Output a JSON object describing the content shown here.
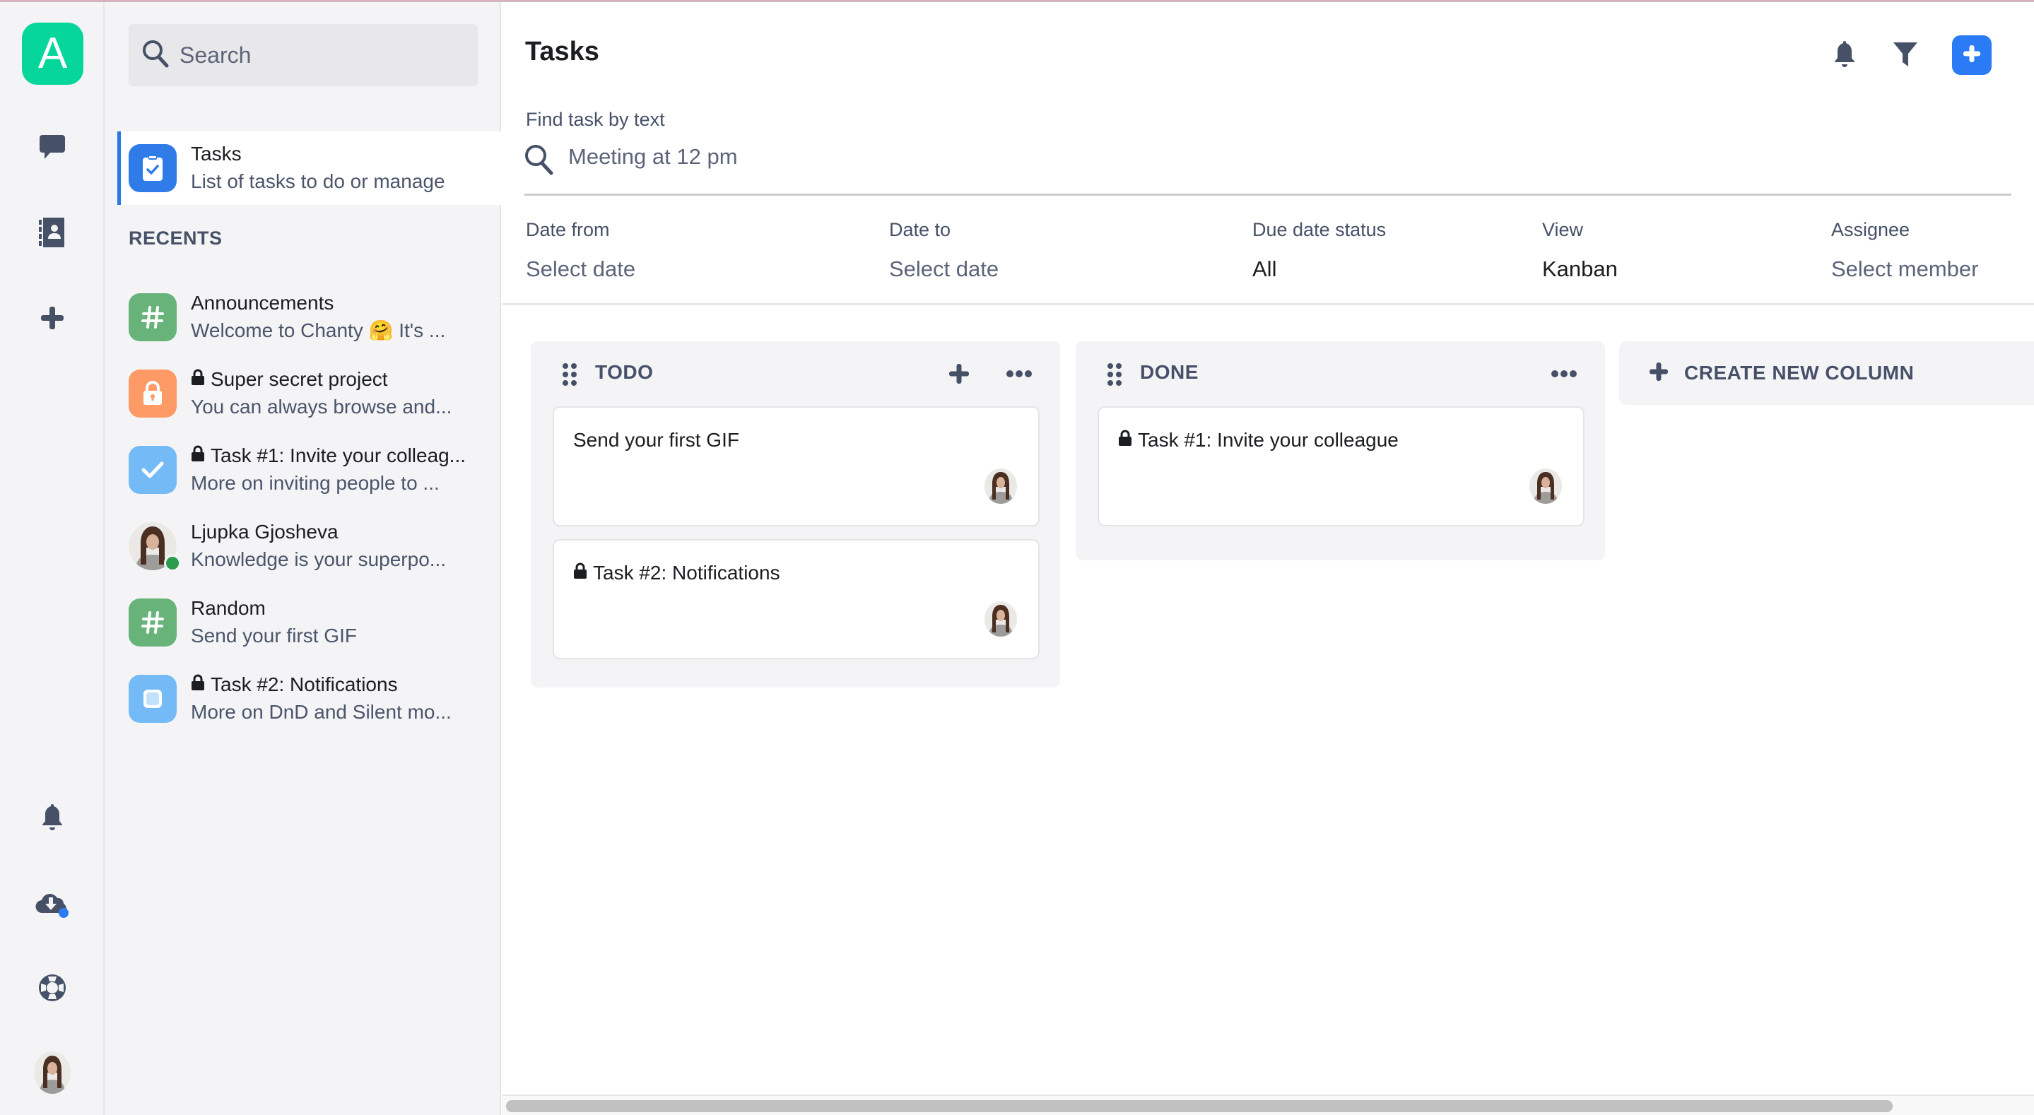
{
  "app": {
    "workspace_initial": "A",
    "brand_color": "#06d69b",
    "accent_color": "#2a7bf5"
  },
  "rail": {
    "top_icons": [
      {
        "name": "chat-icon",
        "label": "Messages"
      },
      {
        "name": "contacts-icon",
        "label": "Contacts"
      },
      {
        "name": "add-icon",
        "label": "Add"
      }
    ],
    "bottom_icons": [
      {
        "name": "bell-icon",
        "label": "Notifications"
      },
      {
        "name": "cloud-download-icon",
        "label": "Download",
        "badge": true
      },
      {
        "name": "lifebuoy-icon",
        "label": "Help"
      },
      {
        "name": "avatar",
        "label": "Profile"
      }
    ]
  },
  "sidebar": {
    "search_placeholder": "Search",
    "active": {
      "title": "Tasks",
      "subtitle": "List of tasks to do or manage",
      "icon": "clipboard-check-icon",
      "color": "#2f7be8"
    },
    "recents_label": "RECENTS",
    "recents": [
      {
        "title": "Announcements",
        "subtitle": "Welcome to Chanty 🤗 It's ...",
        "icon": "hash-icon",
        "color": "#67b37a",
        "locked": false
      },
      {
        "title": "Super secret project",
        "subtitle": "You can always browse and...",
        "icon": "lock-icon",
        "color": "#fd9a66",
        "locked": true
      },
      {
        "title": "Task #1: Invite your colleag...",
        "subtitle": "More on inviting people to ...",
        "icon": "check-icon",
        "color": "#73baf6",
        "locked": true
      },
      {
        "title": "Ljupka Gjosheva",
        "subtitle": "Knowledge is your superpo...",
        "icon": "avatar",
        "color": "",
        "locked": false,
        "online": true
      },
      {
        "title": "Random",
        "subtitle": "Send your first GIF",
        "icon": "hash-icon",
        "color": "#67b37a",
        "locked": false
      },
      {
        "title": "Task #2: Notifications",
        "subtitle": "More on DnD and Silent mo...",
        "icon": "square-icon",
        "color": "#73baf6",
        "locked": true
      }
    ]
  },
  "main": {
    "title": "Tasks",
    "header_icons": [
      "bell-icon",
      "filter-icon",
      "plus-icon"
    ],
    "find": {
      "label": "Find task by text",
      "placeholder": "Meeting at 12 pm",
      "value": ""
    },
    "filters": [
      {
        "label": "Date from",
        "value": "Select date",
        "is_placeholder": true
      },
      {
        "label": "Date to",
        "value": "Select date",
        "is_placeholder": true
      },
      {
        "label": "Due date status",
        "value": "All",
        "is_placeholder": false
      },
      {
        "label": "View",
        "value": "Kanban",
        "is_placeholder": false
      },
      {
        "label": "Assignee",
        "value": "Select member",
        "is_placeholder": true
      }
    ],
    "columns": [
      {
        "title": "TODO",
        "has_add": true,
        "cards": [
          {
            "title": "Send your first GIF",
            "locked": false
          },
          {
            "title": "Task #2: Notifications",
            "locked": true
          }
        ]
      },
      {
        "title": "DONE",
        "has_add": false,
        "cards": [
          {
            "title": "Task #1: Invite your colleague",
            "locked": true
          }
        ]
      }
    ],
    "create_column_label": "CREATE NEW COLUMN",
    "horizontal_scroll_fraction": 0.91
  }
}
